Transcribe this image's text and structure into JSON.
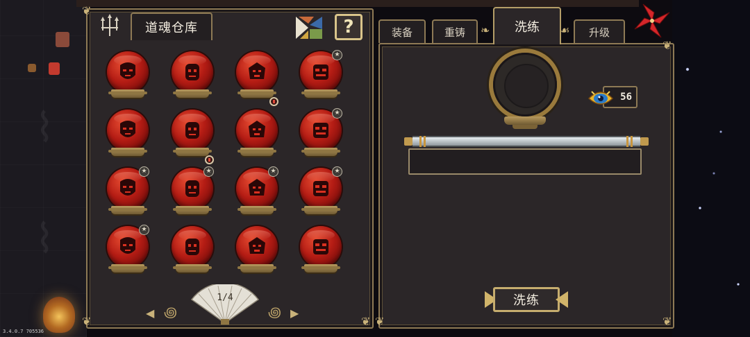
{
  "storage": {
    "title": "道魂仓库",
    "page_indicator": "1/4"
  },
  "souls": [
    {
      "star": false,
      "new": false
    },
    {
      "star": false,
      "new": false
    },
    {
      "star": false,
      "new": true
    },
    {
      "star": true,
      "new": false
    },
    {
      "star": false,
      "new": false
    },
    {
      "star": false,
      "new": true
    },
    {
      "star": false,
      "new": false
    },
    {
      "star": true,
      "new": false
    },
    {
      "star": true,
      "new": false
    },
    {
      "star": true,
      "new": false
    },
    {
      "star": true,
      "new": false
    },
    {
      "star": true,
      "new": false
    },
    {
      "star": true,
      "new": false
    },
    {
      "star": false,
      "new": false
    },
    {
      "star": false,
      "new": false
    },
    {
      "star": false,
      "new": false
    }
  ],
  "tabs": {
    "equip": "装备",
    "recast": "重铸",
    "refine": "洗练",
    "upgrade": "升级",
    "active": "refine"
  },
  "refine": {
    "currency_amount": "56",
    "attribute_text": "",
    "button_label": "洗练"
  },
  "version": "3.4.0.7 705536",
  "colors": {
    "panel_bg": "#2b2628",
    "gold_border": "#8e7a55",
    "orb_red": "#b41c14",
    "text_light": "#f3ede0"
  },
  "icons": {
    "help": "?",
    "star": "★",
    "prev": "◀",
    "next": "▶"
  }
}
